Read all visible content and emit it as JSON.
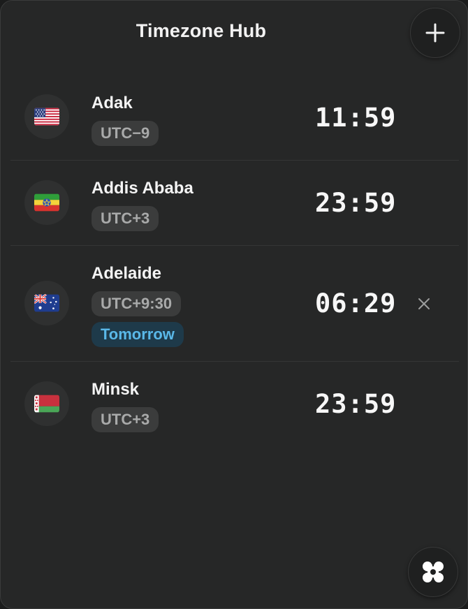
{
  "header": {
    "title": "Timezone Hub",
    "add_icon": "plus-icon"
  },
  "timezones": [
    {
      "city": "Adak",
      "offset": "UTC−9",
      "time": "11:59",
      "flag": "united-states-flag",
      "tomorrow": false
    },
    {
      "city": "Addis Ababa",
      "offset": "UTC+3",
      "time": "23:59",
      "flag": "ethiopia-flag",
      "tomorrow": false
    },
    {
      "city": "Adelaide",
      "offset": "UTC+9:30",
      "time": "06:29",
      "flag": "australia-flag",
      "tomorrow": true,
      "day_label": "Tomorrow",
      "remove_icon": "close-icon"
    },
    {
      "city": "Minsk",
      "offset": "UTC+3",
      "time": "23:59",
      "flag": "belarus-flag",
      "tomorrow": false
    }
  ],
  "footer": {
    "fab_icon": "app-logo-icon"
  },
  "colors": {
    "background": "#262727",
    "text": "#f4f4f4",
    "badge": "#3b3c3c",
    "badge_text": "#a9aaaa",
    "tomorrow_bg": "#1e3a4a",
    "tomorrow_text": "#5ab8e8"
  }
}
